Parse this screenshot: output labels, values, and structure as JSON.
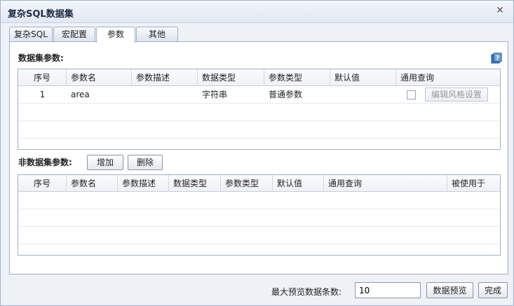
{
  "window": {
    "title": "复杂SQL数据集"
  },
  "tabs": [
    {
      "label": "复杂SQL"
    },
    {
      "label": "宏配置"
    },
    {
      "label": "参数"
    },
    {
      "label": "其他"
    }
  ],
  "dataset_params": {
    "section_label": "数据集参数:",
    "columns": [
      "序号",
      "参数名",
      "参数描述",
      "数据类型",
      "参数类型",
      "默认值",
      "通用查询"
    ],
    "rows": [
      {
        "index": "1",
        "name": "area",
        "description": "",
        "data_type": "字符串",
        "param_type": "普通参数",
        "default": "",
        "general_query_checked": false,
        "style_button": "编辑风格设置"
      }
    ]
  },
  "non_dataset_params": {
    "section_label": "非数据集参数:",
    "add_button": "增加",
    "delete_button": "删除",
    "columns": [
      "序号",
      "参数名",
      "参数描述",
      "数据类型",
      "参数类型",
      "默认值",
      "通用查询",
      "被使用于"
    ]
  },
  "footer": {
    "max_rows_label": "最大预览数据条数:",
    "max_rows_value": "10",
    "preview_button": "数据预览",
    "done_button": "完成"
  }
}
